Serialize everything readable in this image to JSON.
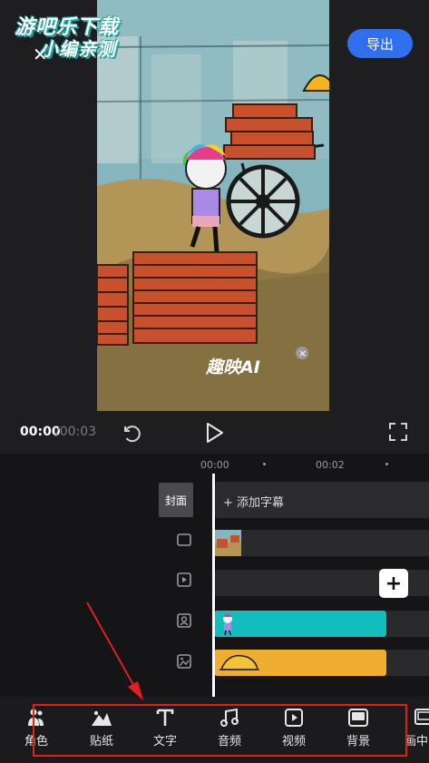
{
  "watermark": {
    "line1": "游吧乐下载",
    "line2": "小编亲测"
  },
  "header": {
    "close_icon": "close-icon",
    "export_label": "导出"
  },
  "video": {
    "overlay_brand": "趣映AI",
    "overlay_close": "×"
  },
  "playback": {
    "current_time": "00:00",
    "total_time": "/00:03"
  },
  "timeline": {
    "ruler": [
      "00:00",
      "00:02"
    ],
    "cover_label": "封面",
    "subtitle_track_label": "+ 添加字幕",
    "add_button": "+"
  },
  "toolbar": {
    "items": [
      {
        "label": "角色",
        "icon": "character-icon"
      },
      {
        "label": "贴纸",
        "icon": "sticker-icon"
      },
      {
        "label": "文字",
        "icon": "text-icon"
      },
      {
        "label": "音频",
        "icon": "music-icon"
      },
      {
        "label": "视频",
        "icon": "video-icon"
      },
      {
        "label": "背景",
        "icon": "background-icon"
      },
      {
        "label": "画中",
        "icon": "pip-icon"
      }
    ]
  },
  "colors": {
    "accent_blue": "#2f6ff0",
    "character_track": "#12bdbd",
    "background_track": "#f0ae31",
    "highlight_red": "#e02020"
  }
}
